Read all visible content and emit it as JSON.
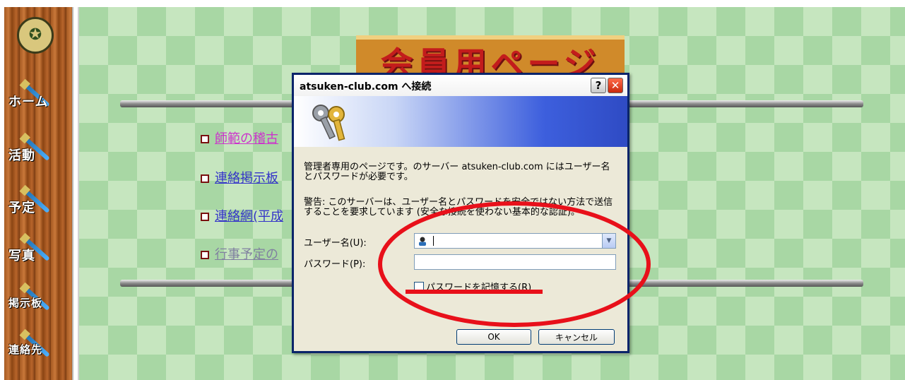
{
  "sidebar": {
    "logo_glyph": "✪",
    "items": [
      {
        "label": "ホーム"
      },
      {
        "label": "活動"
      },
      {
        "label": "予定"
      },
      {
        "label": "写真"
      },
      {
        "label": "掲示板"
      },
      {
        "label": "連絡先"
      }
    ]
  },
  "page": {
    "banner": "会員用ページ",
    "links": [
      {
        "label": "師範の稽古"
      },
      {
        "label": "連絡掲示板"
      },
      {
        "label": "連絡網(平成"
      },
      {
        "label": "行事予定の"
      }
    ]
  },
  "dialog": {
    "title": "atsuken-club.com へ接続",
    "help_label": "?",
    "close_label": "✕",
    "message1": "管理者専用のページです。のサーバー atsuken-club.com にはユーザー名とパスワードが必要です。",
    "message2": "警告: このサーバーは、ユーザー名とパスワードを安全ではない方法で送信することを要求しています (安全な接続を使わない基本的な認証)。",
    "username_label": "ユーザー名(U):",
    "password_label": "パスワード(P):",
    "username_value": "",
    "password_value": "",
    "remember_label": "パスワードを記憶する(R)",
    "ok_label": "OK",
    "cancel_label": "キャンセル"
  },
  "colors": {
    "annotation": "#e8101a",
    "close_button": "#d8401c"
  }
}
